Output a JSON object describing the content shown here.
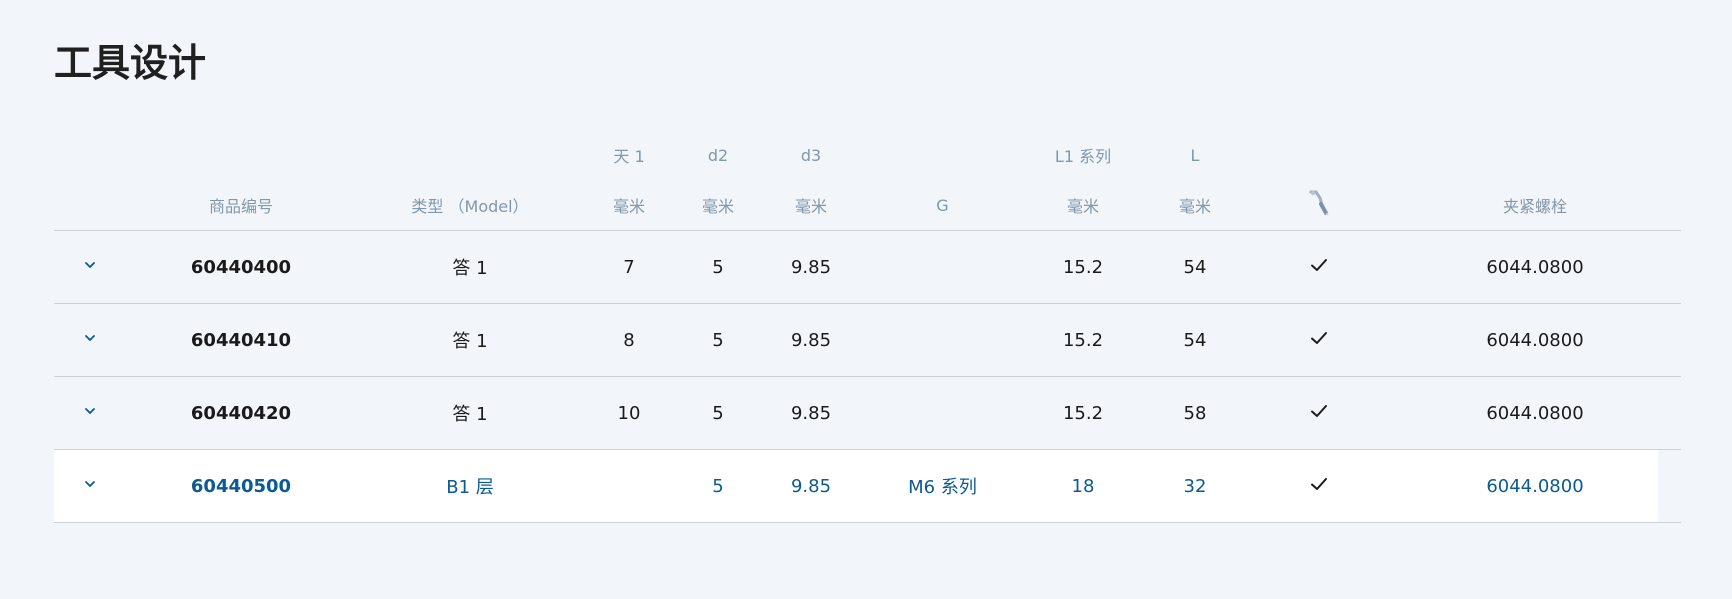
{
  "page": {
    "title": "工具设计"
  },
  "table": {
    "headers_top": {
      "d1": "天 1",
      "d2": "d2",
      "d3": "d3",
      "l1": "L1 系列",
      "l": "L"
    },
    "headers": {
      "article": "商品编号",
      "type": "类型 （Model）",
      "d1_unit": "毫米",
      "d2_unit": "毫米",
      "d3_unit": "毫米",
      "g": "G",
      "l1_unit": "毫米",
      "l_unit": "毫米",
      "coolant_icon": "coolant-icon",
      "bolt": "夹紧螺栓"
    },
    "rows": [
      {
        "article": "60440400",
        "type": "答 1",
        "d1": "7",
        "d2": "5",
        "d3": "9.85",
        "g": "",
        "l1": "15.2",
        "l": "54",
        "coolant": true,
        "bolt": "6044.0800",
        "highlighted": false
      },
      {
        "article": "60440410",
        "type": "答 1",
        "d1": "8",
        "d2": "5",
        "d3": "9.85",
        "g": "",
        "l1": "15.2",
        "l": "54",
        "coolant": true,
        "bolt": "6044.0800",
        "highlighted": false
      },
      {
        "article": "60440420",
        "type": "答 1",
        "d1": "10",
        "d2": "5",
        "d3": "9.85",
        "g": "",
        "l1": "15.2",
        "l": "58",
        "coolant": true,
        "bolt": "6044.0800",
        "highlighted": false
      },
      {
        "article": "60440500",
        "type": "B1 层",
        "d1": "",
        "d2": "5",
        "d3": "9.85",
        "g": "M6 系列",
        "l1": "18",
        "l": "32",
        "coolant": true,
        "bolt": "6044.0800",
        "highlighted": true
      }
    ]
  },
  "colors": {
    "background": "#f2f6fa",
    "header_text": "#8397aa",
    "accent": "#0b5a94",
    "divider": "#c9d1d9"
  }
}
